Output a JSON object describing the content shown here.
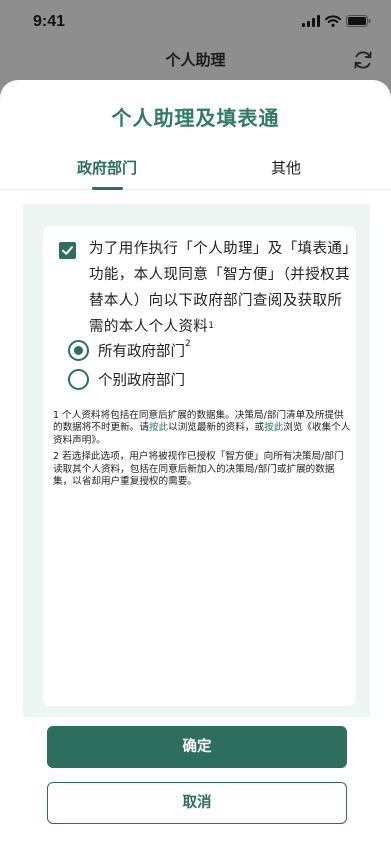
{
  "status": {
    "time": "9:41"
  },
  "header": {
    "title": "个人助理"
  },
  "sheet": {
    "title": "个人助理及填表通"
  },
  "tabs": [
    {
      "label": "政府部门",
      "active": true
    },
    {
      "label": "其他",
      "active": false
    }
  ],
  "consent": {
    "checked": true,
    "text": "为了用作执行「个人助理」及「填表通」功能，本人现同意「智方便」（并授权其替本人）向以下政府部门查阅及获取所需的本人个人资料",
    "footnote": "1"
  },
  "options": [
    {
      "label": "所有政府部门",
      "footnote": "2",
      "selected": true
    },
    {
      "label": "个别政府部门",
      "footnote": "",
      "selected": false
    }
  ],
  "notes": {
    "note1_a": "1 个人资料将包括在同意后扩展的数据集。决策局/部门清单及所提供的数据将不时更新。请",
    "note1_link1": "按此",
    "note1_b": "以浏览最新的资料，或",
    "note1_link2": "按此",
    "note1_c": "浏览《收集个人资料声明》。",
    "note2": "2 若选择此选项，用户将被视作已授权「智方便」向所有决策局/部门读取其个人资料，包括在同意后新加入的决策局/部门或扩展的数据集，以省却用户重复授权的需要。"
  },
  "buttons": {
    "confirm": "确定",
    "cancel": "取消"
  },
  "colors": {
    "accent": "#2e6e5f",
    "title": "#2e7a66",
    "panel": "#eef6f3",
    "backdrop": "#8e8e8e"
  },
  "icons": [
    "signal-icon",
    "wifi-icon",
    "battery-icon",
    "refresh-icon",
    "checkbox-checked-icon",
    "radio-icon"
  ]
}
